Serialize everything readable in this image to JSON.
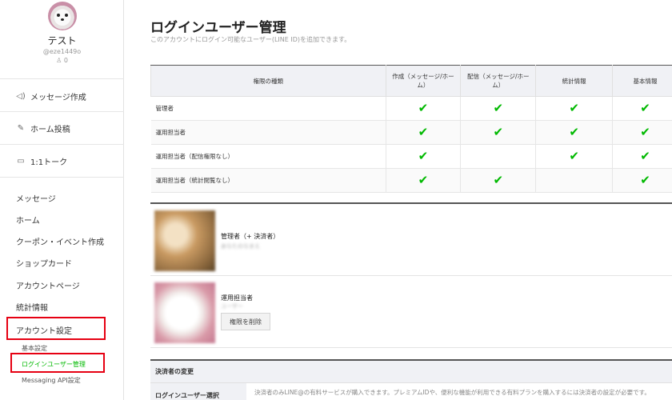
{
  "account": {
    "name": "テスト",
    "id": "@eze1449o",
    "friends": "0"
  },
  "quick_actions": [
    {
      "label": "メッセージ作成",
      "icon": "speaker-icon"
    },
    {
      "label": "ホーム投稿",
      "icon": "pencil-icon"
    },
    {
      "label": "1:1トーク",
      "icon": "chat-icon"
    }
  ],
  "menu": [
    {
      "label": "メッセージ"
    },
    {
      "label": "ホーム"
    },
    {
      "label": "クーポン・イベント作成"
    },
    {
      "label": "ショップカード"
    },
    {
      "label": "アカウントページ"
    },
    {
      "label": "統計情報"
    },
    {
      "label": "アカウント設定"
    }
  ],
  "submenu": [
    {
      "label": "基本設定"
    },
    {
      "label": "ログインユーザー管理"
    },
    {
      "label": "Messaging API設定"
    }
  ],
  "page": {
    "title": "ログインユーザー管理",
    "subtitle": "このアカウントにログイン可能なユーザー(LINE ID)を追加できます。"
  },
  "permissions": {
    "headers": [
      "権限の種類",
      "作成（メッセージ/ホーム）",
      "配信（メッセージ/ホーム）",
      "統計情報",
      "基本情報"
    ],
    "rows": [
      {
        "role": "管理者",
        "checks": [
          true,
          true,
          true,
          true
        ]
      },
      {
        "role": "運用担当者",
        "checks": [
          true,
          true,
          true,
          true
        ]
      },
      {
        "role": "運用担当者（配信権限なし）",
        "checks": [
          true,
          false,
          true,
          true
        ]
      },
      {
        "role": "運用担当者（統計閲覧なし）",
        "checks": [
          true,
          true,
          false,
          true
        ]
      }
    ]
  },
  "users": [
    {
      "role": "管理者（+ 決済者）",
      "name": "あなたのなまえ"
    },
    {
      "role": "運用担当者",
      "name": "ユーザー",
      "button": "権限を削除"
    }
  ],
  "payer": {
    "section_title": "決済者の変更",
    "row_label": "ログインユーザー選択",
    "description": "決済者のみLINE@の有料サービスが購入できます。プレミアムIDや、便利な機能が利用できる有料プランを購入するには決済者の設定が必要です。"
  },
  "colors": {
    "accent": "#00b900",
    "highlight": "#e60012",
    "header_bg": "#f0f1f5"
  },
  "check_icon": "✔"
}
